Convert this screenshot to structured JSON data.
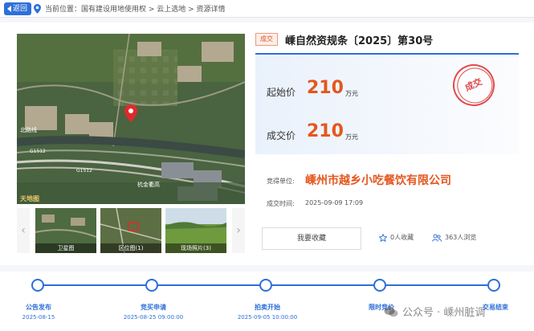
{
  "topbar": {
    "back_label": "返回",
    "breadcrumb": "当前位置：国有建设用地使用权 > 云上选地 > 资源详情"
  },
  "map": {
    "labels": [
      "北路线",
      "G1512",
      "G1512",
      "杭金衢高"
    ],
    "logo": "天地图"
  },
  "thumbnails": [
    {
      "label": "卫星图"
    },
    {
      "label": "区位图(1)"
    },
    {
      "label": "现场照片(3)"
    }
  ],
  "listing": {
    "status_tag": "成交",
    "title": "嵊自然资规条〔2025〕第30号",
    "start_price_label": "起始价",
    "start_price_value": "210",
    "start_price_unit": "万元",
    "deal_price_label": "成交价",
    "deal_price_value": "210",
    "deal_price_unit": "万元",
    "stamp_text": "成交",
    "winner_label": "竞得单位:",
    "winner_value": "嵊州市越乡小吃餐饮有限公司",
    "deal_time_label": "成交时间:",
    "deal_time_value": "2025-09-09 17:09"
  },
  "actions": {
    "favorite_button": "我要收藏",
    "favorites_count": "0人收藏",
    "views_count": "363人浏览"
  },
  "timeline": [
    {
      "label": "公告发布",
      "date": "2025-08-15"
    },
    {
      "label": "竞买申请",
      "date": "2025-08-25 09:00:00"
    },
    {
      "label": "拍卖开始",
      "date": "2025-09-05 10:00:00"
    },
    {
      "label": "限时竞价",
      "date": ""
    },
    {
      "label": "交易结束",
      "date": ""
    }
  ],
  "watermark": "公众号 · 嵊州脏调",
  "colors": {
    "primary": "#2e6fd8",
    "price": "#e4571e",
    "stamp": "#e14b4b",
    "tag_bg": "#fdeee6"
  }
}
